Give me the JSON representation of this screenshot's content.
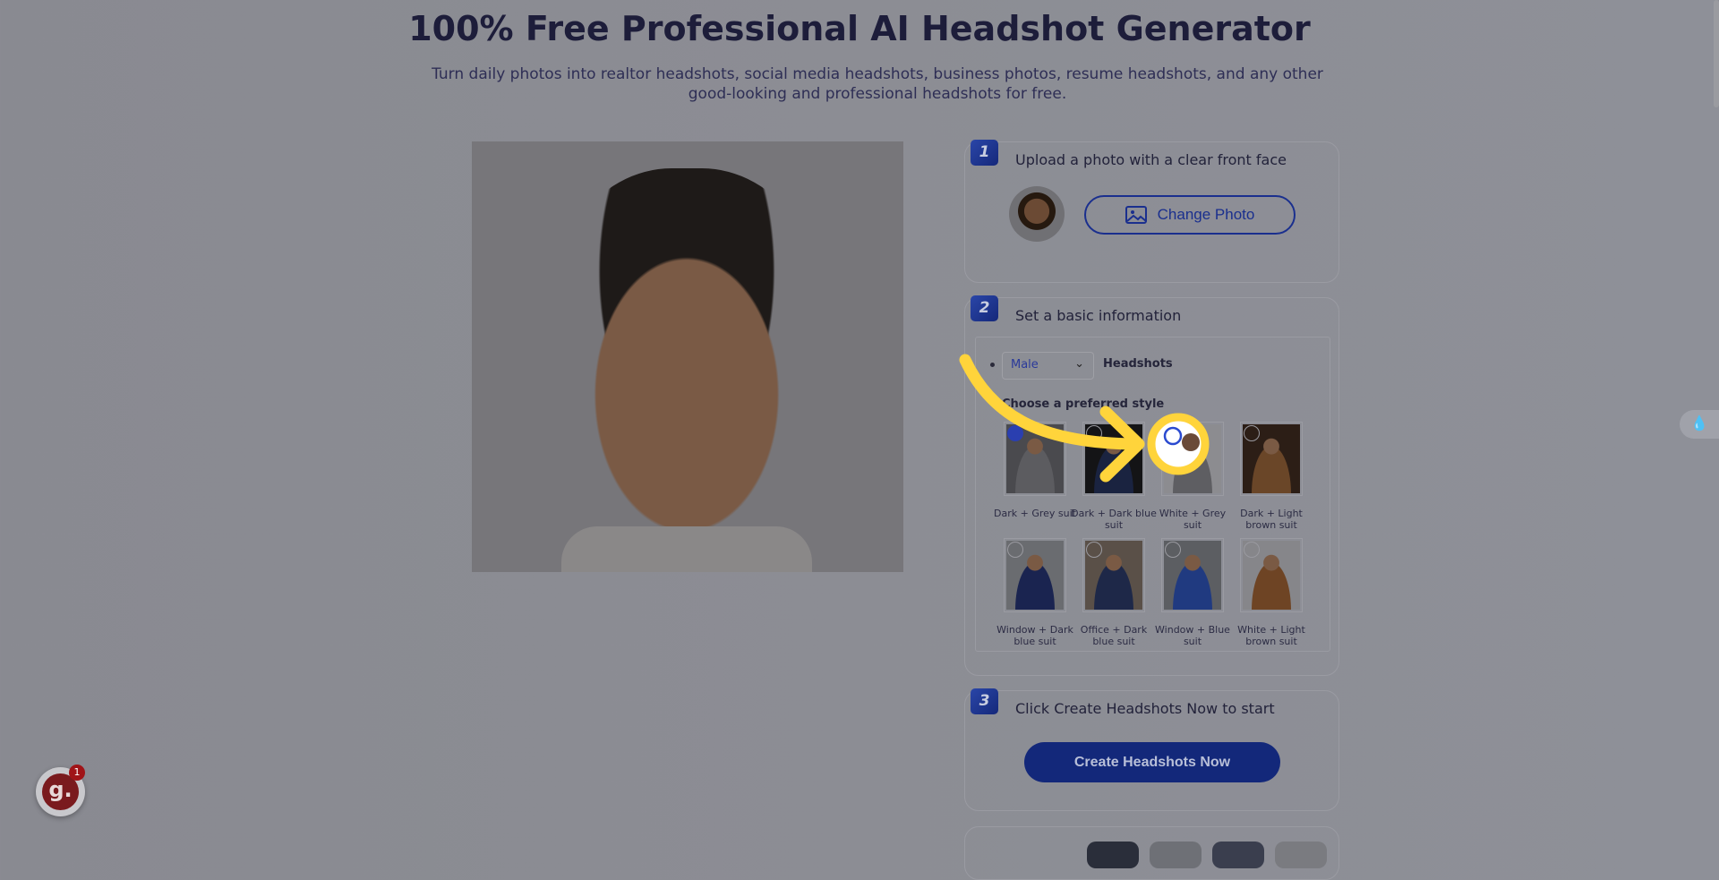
{
  "header": {
    "title": "100% Free Professional AI Headshot Generator",
    "subtitle_line1": "Turn daily photos into realtor headshots, social media headshots, business photos, resume headshots, and any other",
    "subtitle_line2": "good-looking and professional headshots for free."
  },
  "step1": {
    "number": "1",
    "title": "Upload a photo with a clear front face",
    "button": "Change Photo",
    "icon": "image-icon"
  },
  "step2": {
    "number": "2",
    "title": "Set a basic information",
    "gender": "Male",
    "headshots_label": "Headshots",
    "style_heading": "Choose a preferred style",
    "styles": [
      {
        "label": "Dark + Grey suit",
        "bg": "#4a4a4e",
        "suit": "#5c5c60",
        "selected": true
      },
      {
        "label": "Dark + Dark blue suit",
        "bg": "#141416",
        "suit": "#1a2340",
        "selected": false
      },
      {
        "label": "White + Grey suit",
        "bg": "#8c8c90",
        "suit": "#5e5e62",
        "selected": false
      },
      {
        "label": "Dark + Light brown suit",
        "bg": "#2c1e16",
        "suit": "#6a4628",
        "selected": false
      },
      {
        "label": "Window + Dark blue suit",
        "bg": "#6a6c70",
        "suit": "#1a2450",
        "selected": false
      },
      {
        "label": "Office + Dark blue suit",
        "bg": "#5a5048",
        "suit": "#1e2848",
        "selected": false
      },
      {
        "label": "Window + Blue suit",
        "bg": "#5c5e62",
        "suit": "#203a80",
        "selected": false
      },
      {
        "label": "White + Light brown suit",
        "bg": "#86868a",
        "suit": "#6e4424",
        "selected": false
      }
    ]
  },
  "step3": {
    "number": "3",
    "title": "Click Create Headshots Now to start",
    "button": "Create Headshots Now"
  },
  "widgets": {
    "badge_letter": "g.",
    "badge_count": "1"
  },
  "colors": {
    "accent": "#1a2f8e",
    "highlight": "#ffd43b"
  }
}
